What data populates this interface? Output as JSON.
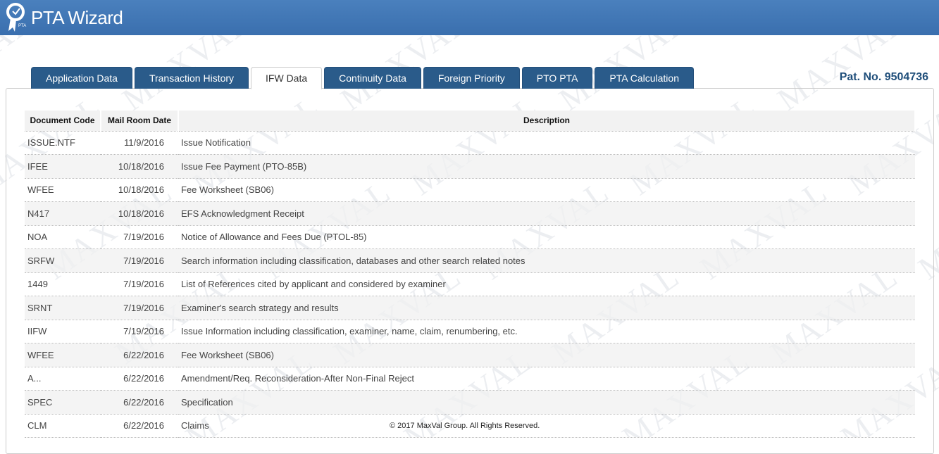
{
  "app": {
    "title": "PTA Wizard",
    "logo_text": "PTA",
    "watermark": "MAXVAL"
  },
  "tabs": [
    "Application Data",
    "Transaction History",
    "IFW Data",
    "Continuity Data",
    "Foreign Priority",
    "PTO PTA",
    "PTA Calculation"
  ],
  "active_tab": "IFW Data",
  "pat_no": "Pat. No. 9504736",
  "table": {
    "headers": [
      "Document Code",
      "Mail Room Date",
      "Description"
    ],
    "rows": [
      [
        "ISSUE.NTF",
        "11/9/2016",
        "Issue Notification"
      ],
      [
        "IFEE",
        "10/18/2016",
        "Issue Fee Payment (PTO-85B)"
      ],
      [
        "WFEE",
        "10/18/2016",
        "Fee Worksheet (SB06)"
      ],
      [
        "N417",
        "10/18/2016",
        "EFS Acknowledgment Receipt"
      ],
      [
        "NOA",
        "7/19/2016",
        "Notice of Allowance and Fees Due (PTOL-85)"
      ],
      [
        "SRFW",
        "7/19/2016",
        "Search information including classification, databases and other search related notes"
      ],
      [
        "1449",
        "7/19/2016",
        "List of References cited by applicant and considered by examiner"
      ],
      [
        "SRNT",
        "7/19/2016",
        "Examiner's search strategy and results"
      ],
      [
        "IIFW",
        "7/19/2016",
        "Issue Information including classification, examiner, name, claim, renumbering, etc."
      ],
      [
        "WFEE",
        "6/22/2016",
        "Fee Worksheet (SB06)"
      ],
      [
        "A...",
        "6/22/2016",
        "Amendment/Req. Reconsideration-After Non-Final Reject"
      ],
      [
        "SPEC",
        "6/22/2016",
        "Specification"
      ],
      [
        "CLM",
        "6/22/2016",
        "Claims"
      ]
    ]
  },
  "footer": "© 2017 MaxVal Group. All Rights Reserved."
}
